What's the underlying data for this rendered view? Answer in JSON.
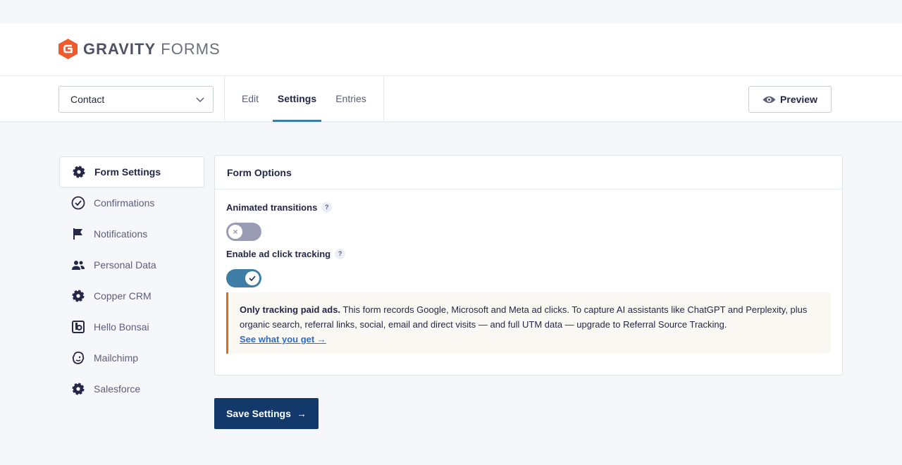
{
  "brand": {
    "name_bold": "GRAVITY",
    "name_light": "FORMS",
    "logo_color": "#f15a2b"
  },
  "toolbar": {
    "form_select_value": "Contact",
    "tabs": [
      {
        "label": "Edit",
        "active": false
      },
      {
        "label": "Settings",
        "active": true
      },
      {
        "label": "Entries",
        "active": false
      }
    ],
    "preview_label": "Preview"
  },
  "sidebar": {
    "items": [
      {
        "label": "Form Settings",
        "icon": "gear-icon",
        "active": true
      },
      {
        "label": "Confirmations",
        "icon": "check-circle-icon",
        "active": false
      },
      {
        "label": "Notifications",
        "icon": "flag-icon",
        "active": false
      },
      {
        "label": "Personal Data",
        "icon": "users-icon",
        "active": false
      },
      {
        "label": "Copper CRM",
        "icon": "gear-icon",
        "active": false
      },
      {
        "label": "Hello Bonsai",
        "icon": "bonsai-icon",
        "active": false
      },
      {
        "label": "Mailchimp",
        "icon": "mailchimp-icon",
        "active": false
      },
      {
        "label": "Salesforce",
        "icon": "gear-icon",
        "active": false
      }
    ]
  },
  "panel": {
    "title": "Form Options",
    "animated_transitions": {
      "label": "Animated transitions",
      "help": "?",
      "enabled": false
    },
    "ad_click_tracking": {
      "label": "Enable ad click tracking",
      "help": "?",
      "enabled": true
    },
    "notice": {
      "bold": "Only tracking paid ads.",
      "text": "This form records Google, Microsoft and Meta ad clicks. To capture AI assistants like ChatGPT and Perplexity, plus organic search, referral links, social, email and direct visits — and full UTM data — upgrade to Referral Source Tracking.",
      "link": "See what you get →",
      "accent_color": "#dd6b20"
    }
  },
  "save_button": {
    "label": "Save Settings",
    "arrow": "→",
    "color": "#13396b"
  }
}
